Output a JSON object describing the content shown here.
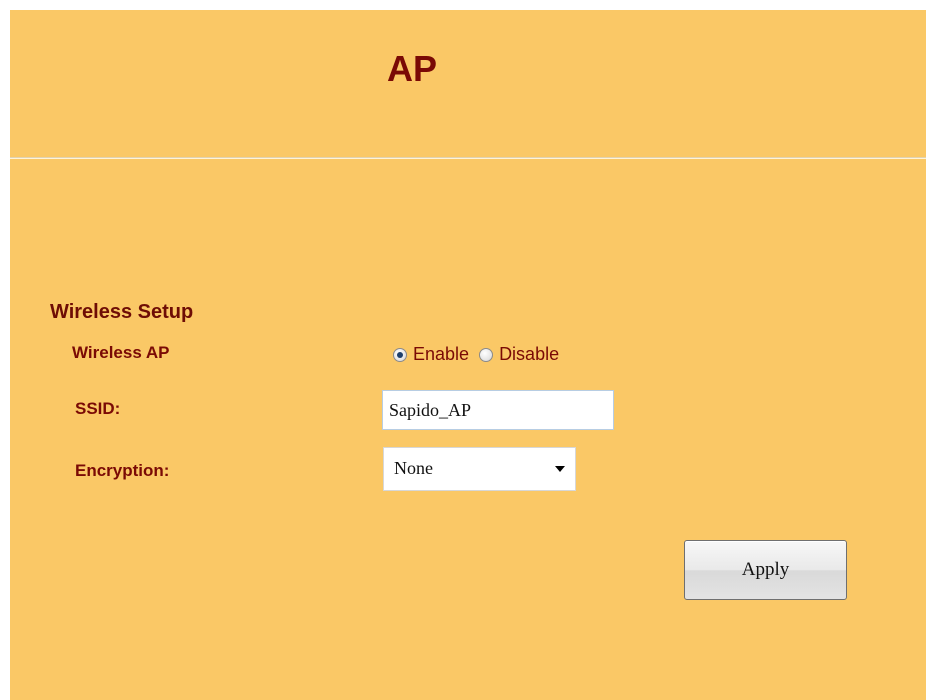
{
  "page": {
    "title": "AP"
  },
  "wireless_setup": {
    "heading": "Wireless Setup",
    "wireless_ap": {
      "label": "Wireless AP",
      "options": [
        {
          "label": "Enable",
          "checked": true
        },
        {
          "label": "Disable",
          "checked": false
        }
      ]
    },
    "ssid": {
      "label": "SSID:",
      "value": "Sapido_AP"
    },
    "encryption": {
      "label": "Encryption:",
      "selected": "None"
    },
    "apply_label": "Apply"
  },
  "colors": {
    "background": "#fac866",
    "text_accent": "#7a0a05"
  }
}
